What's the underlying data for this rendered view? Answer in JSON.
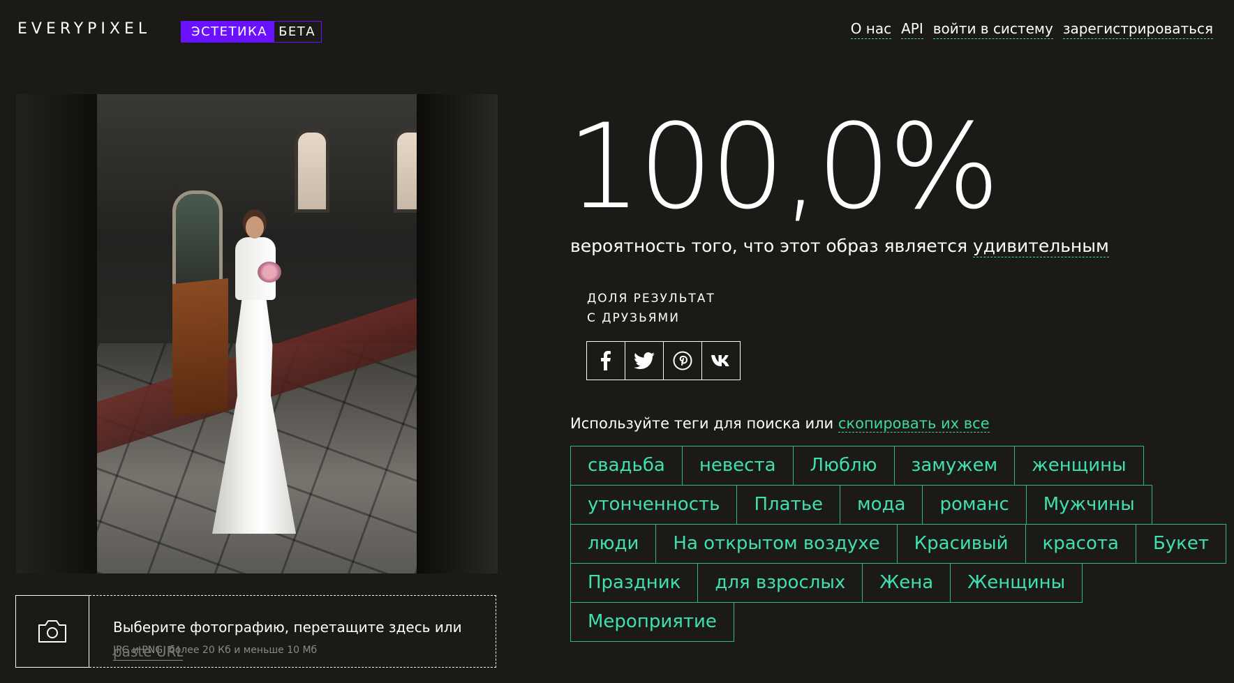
{
  "header": {
    "logo": "EVERYPIXEL",
    "product_name": "ЭСТЕТИКА",
    "product_badge": "БЕТА",
    "nav": [
      {
        "label": "О нас"
      },
      {
        "label": "API"
      },
      {
        "label": "войти в систему"
      },
      {
        "label": "зарегистрироваться"
      }
    ]
  },
  "result": {
    "score": "100,0%",
    "caption_prefix": "вероятность того, что этот образ является ",
    "caption_term": "удивительным"
  },
  "share": {
    "label_line1": "ДОЛЯ РЕЗУЛЬТАТ",
    "label_line2": "С ДРУЗЬЯМИ",
    "buttons": [
      {
        "icon": "facebook-icon",
        "glyph": "f"
      },
      {
        "icon": "twitter-icon",
        "glyph": "t"
      },
      {
        "icon": "pinterest-icon",
        "glyph": "p"
      },
      {
        "icon": "vk-icon",
        "glyph": "vk"
      }
    ]
  },
  "tags_section": {
    "intro": "Используйте теги для поиска или ",
    "copy_all": "скопировать их все",
    "rows": [
      [
        "свадьба",
        "невеста",
        "Люблю",
        "замужем",
        "женщины"
      ],
      [
        "утонченность",
        "Платье",
        "мода",
        "романс",
        "Мужчины"
      ],
      [
        "люди",
        "На открытом воздухе",
        "Красивый",
        "красота",
        "Букет"
      ],
      [
        "Праздник",
        "для взрослых",
        "Жена",
        "Женщины"
      ],
      [
        "Мероприятие"
      ]
    ]
  },
  "upload": {
    "drop_text": "Выберите фотографию, перетащите здесь или",
    "formats": "JPG и PNG, более 20 Кб и меньше 10 Мб",
    "paste_placeholder": "paste URL"
  },
  "colors": {
    "background": "#1b1a16",
    "accent_purple": "#6a12ff",
    "accent_green": "#3fd6a8"
  }
}
